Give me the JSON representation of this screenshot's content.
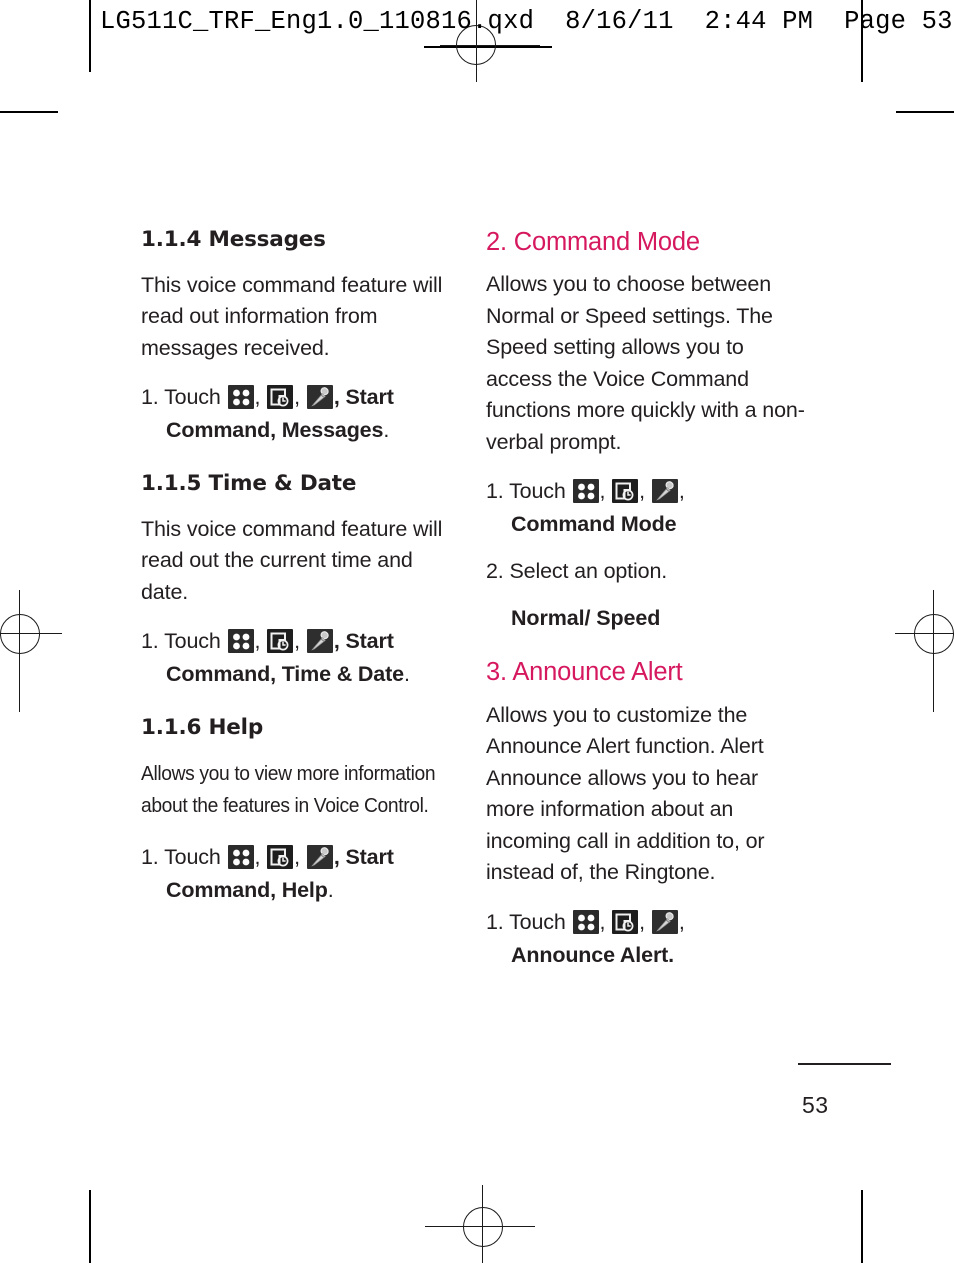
{
  "header": {
    "imprint": "LG511C_TRF_Eng1.0_110816.qxd  8/16/11  2:44 PM  Page 53"
  },
  "colors": {
    "heading_accent": "#d6185f",
    "text": "#231f20",
    "icon_bg_dark": "#2b2b2b"
  },
  "icons": {
    "menu": "four-dot-menu-icon",
    "recent": "clock-square-recent-icon",
    "mic": "microphone-icon"
  },
  "left_column": {
    "sections": [
      {
        "heading": "1.1.4 Messages",
        "body": "This voice command feature will read out information from messages received.",
        "body_style": "normal",
        "step_number": "1. Touch ",
        "step_tail": ", Start",
        "step_cont": "Command, Messages",
        "step_cont_period": "."
      },
      {
        "heading": "1.1.5 Time & Date",
        "body": "This voice command feature will read out the current time and date.",
        "body_style": "normal",
        "step_number": "1. Touch ",
        "step_tail": ", Start",
        "step_cont": "Command, Time & Date",
        "step_cont_period": "."
      },
      {
        "heading": "1.1.6 Help",
        "body": "Allows you to view more information about the features in Voice Control.",
        "body_style": "condensed",
        "step_number": "1. Touch ",
        "step_tail": ", Start",
        "step_cont": "Command, Help",
        "step_cont_period": "."
      }
    ]
  },
  "right_column": {
    "sections": [
      {
        "heading": "2. Command Mode",
        "body": "Allows you to choose between Normal or Speed settings. The Speed setting allows you to access the Voice Command functions more quickly with a non-verbal prompt.",
        "step_number": "1. Touch ",
        "step_tail": ",",
        "step_cont": "Command Mode",
        "step2": "2. Select an option.",
        "option_line": "Normal/ Speed"
      },
      {
        "heading": "3. Announce Alert",
        "body": "Allows you to customize the Announce Alert function. Alert Announce allows you to hear more information about an incoming call in addition to, or instead of, the Ringtone.",
        "step_number": "1. Touch ",
        "step_tail": ",",
        "step_cont": "Announce Alert."
      }
    ]
  },
  "footer": {
    "page_number": "53"
  }
}
